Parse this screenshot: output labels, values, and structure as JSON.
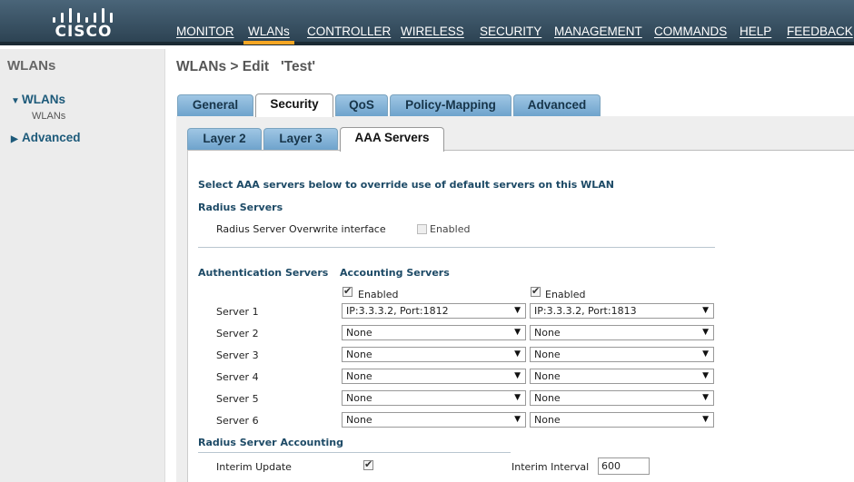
{
  "brand": {
    "logo_text": "CISCO"
  },
  "nav": [
    {
      "label": "MONITOR"
    },
    {
      "label": "WLANs"
    },
    {
      "label": "CONTROLLER"
    },
    {
      "label": "WIRELESS"
    },
    {
      "label": "SECURITY"
    },
    {
      "label": "MANAGEMENT"
    },
    {
      "label": "COMMANDS"
    },
    {
      "label": "HELP"
    },
    {
      "label": "FEEDBACK"
    }
  ],
  "colors": {
    "active_nav_accent": "#f5a623",
    "topbar": "#3a5466",
    "tab_blue": "#8ebddf"
  },
  "sidebar": {
    "title": "WLANs",
    "items": [
      {
        "label": "WLANs",
        "expanded": true,
        "sub": "WLANs"
      },
      {
        "label": "Advanced",
        "expanded": false
      }
    ]
  },
  "page": {
    "title": "WLANs > Edit   'Test'"
  },
  "tabs_main": [
    {
      "label": "General"
    },
    {
      "label": "Security",
      "active": true
    },
    {
      "label": "QoS"
    },
    {
      "label": "Policy-Mapping"
    },
    {
      "label": "Advanced"
    }
  ],
  "tabs_security": [
    {
      "label": "Layer 2"
    },
    {
      "label": "Layer 3"
    },
    {
      "label": "AAA Servers",
      "active": true
    }
  ],
  "aaa": {
    "intro": "Select AAA servers below to override use of default servers on this WLAN",
    "radius_heading": "Radius Servers",
    "overwrite_label": "Radius Server Overwrite interface",
    "overwrite_enabled_label": "Enabled",
    "overwrite_checked": false,
    "auth_heading": "Authentication Servers",
    "acct_heading": "Accounting Servers",
    "auth_enabled_label": "Enabled",
    "auth_enabled": true,
    "acct_enabled_label": "Enabled",
    "acct_enabled": true,
    "servers": [
      {
        "label": "Server 1",
        "auth": "IP:3.3.3.2, Port:1812",
        "acct": "IP:3.3.3.2, Port:1813"
      },
      {
        "label": "Server 2",
        "auth": "None",
        "acct": "None"
      },
      {
        "label": "Server 3",
        "auth": "None",
        "acct": "None"
      },
      {
        "label": "Server 4",
        "auth": "None",
        "acct": "None"
      },
      {
        "label": "Server 5",
        "auth": "None",
        "acct": "None"
      },
      {
        "label": "Server 6",
        "auth": "None",
        "acct": "None"
      }
    ],
    "accounting_heading": "Radius Server Accounting",
    "interim_update_label": "Interim Update",
    "interim_update_checked": true,
    "interim_interval_label": "Interim Interval",
    "interim_interval_value": "600"
  }
}
